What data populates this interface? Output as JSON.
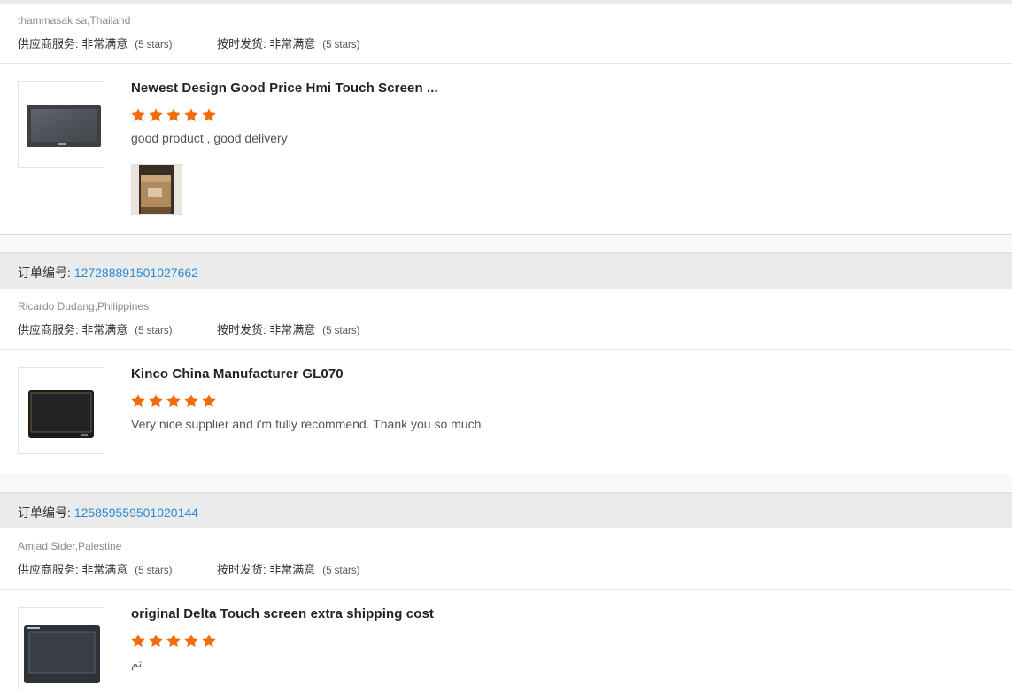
{
  "colors": {
    "star": "#f26c0c",
    "link": "#2a8ad4",
    "band": "#ebebeb"
  },
  "labels": {
    "order_prefix": "订单编号: ",
    "supplier_service": "供应商服务: ",
    "on_time_delivery": "按时发货: ",
    "rating_text": "非常满意",
    "stars_text": "(5 stars)"
  },
  "reviews": [
    {
      "buyer": "thammasak sa,Thailand",
      "product_title": "Newest Design Good Price Hmi Touch Screen ...",
      "rating": 5,
      "comment": "good product , good delivery",
      "thumb_icon": "hmi-screen-icon",
      "photo_icon": "box-photo-icon"
    },
    {
      "order_number": "127288891501027662",
      "buyer": "Ricardo Dudang,Philippines",
      "product_title": "Kinco China Manufacturer GL070",
      "rating": 5,
      "comment": "Very nice supplier and i'm fully recommend. Thank you so much.",
      "thumb_icon": "hmi-screen-icon"
    },
    {
      "order_number": "125859559501020144",
      "buyer": "Amjad Sider,Palestine",
      "product_title": "original Delta Touch screen extra shipping cost",
      "rating": 5,
      "comment": "تم",
      "thumb_icon": "hmi-screen-icon"
    }
  ]
}
